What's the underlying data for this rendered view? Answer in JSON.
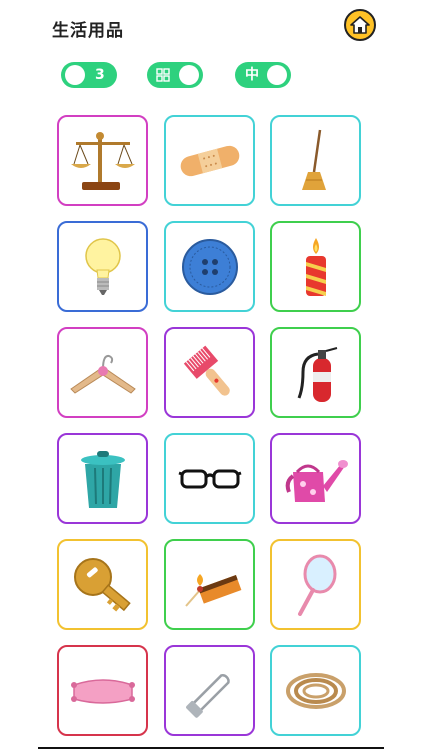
{
  "header": {
    "title": "生活用品"
  },
  "toggles": {
    "count": {
      "label": "3"
    },
    "layout": {
      "icon": "grid-icon"
    },
    "difficulty": {
      "label": "中"
    }
  },
  "colors": {
    "toggle_green": "#2ed17e",
    "home_yellow": "#ffc226",
    "border_magenta": "#d23fc2",
    "border_cyan": "#43d2d6",
    "border_blue": "#3a6cd6",
    "border_green": "#3fcf4d",
    "border_purple": "#9a36d8",
    "border_orange": "#f2c230",
    "border_red": "#d6344c"
  },
  "items": [
    {
      "icon": "balance-scale-icon",
      "border": "#d23fc2"
    },
    {
      "icon": "bandage-icon",
      "border": "#43d2d6"
    },
    {
      "icon": "broom-icon",
      "border": "#43d2d6"
    },
    {
      "icon": "light-bulb-icon",
      "border": "#3a6cd6"
    },
    {
      "icon": "button-icon",
      "border": "#43d2d6"
    },
    {
      "icon": "candle-icon",
      "border": "#3fcf4d"
    },
    {
      "icon": "hanger-icon",
      "border": "#d23fc2"
    },
    {
      "icon": "comb-icon",
      "border": "#9a36d8"
    },
    {
      "icon": "fire-extinguisher-icon",
      "border": "#3fcf4d"
    },
    {
      "icon": "trash-can-icon",
      "border": "#9a36d8"
    },
    {
      "icon": "glasses-icon",
      "border": "#43d2d6"
    },
    {
      "icon": "watering-can-icon",
      "border": "#9a36d8"
    },
    {
      "icon": "key-icon",
      "border": "#f2c230"
    },
    {
      "icon": "matches-icon",
      "border": "#3fcf4d"
    },
    {
      "icon": "hand-mirror-icon",
      "border": "#f2c230"
    },
    {
      "icon": "cushion-icon",
      "border": "#d6344c"
    },
    {
      "icon": "safety-pin-icon",
      "border": "#9a36d8"
    },
    {
      "icon": "rope-icon",
      "border": "#43d2d6"
    }
  ]
}
